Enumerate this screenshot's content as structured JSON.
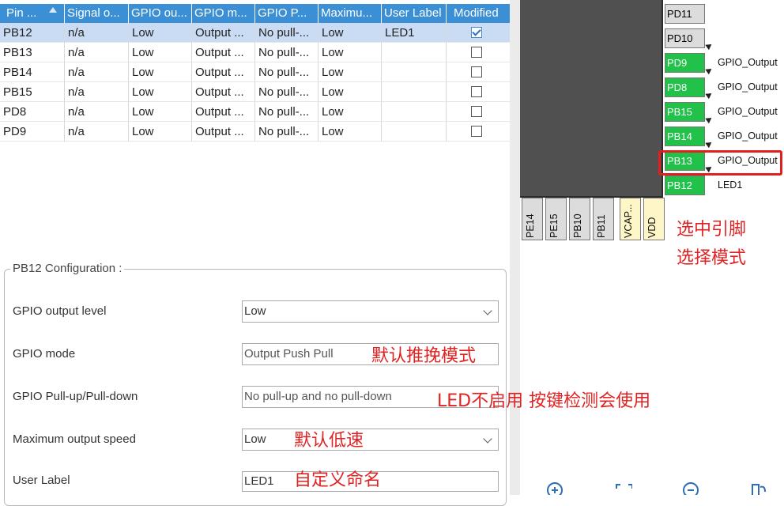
{
  "pin_table": {
    "columns": [
      "Pin ...",
      "Signal o...",
      "GPIO ou...",
      "GPIO m...",
      "GPIO P...",
      "Maximu...",
      "User Label",
      "Modified"
    ],
    "rows": [
      {
        "pin": "PB12",
        "signal": "n/a",
        "level": "Low",
        "mode": "Output ...",
        "pull": "No pull-...",
        "speed": "Low",
        "label": "LED1",
        "modified": true
      },
      {
        "pin": "PB13",
        "signal": "n/a",
        "level": "Low",
        "mode": "Output ...",
        "pull": "No pull-...",
        "speed": "Low",
        "label": "",
        "modified": false
      },
      {
        "pin": "PB14",
        "signal": "n/a",
        "level": "Low",
        "mode": "Output ...",
        "pull": "No pull-...",
        "speed": "Low",
        "label": "",
        "modified": false
      },
      {
        "pin": "PB15",
        "signal": "n/a",
        "level": "Low",
        "mode": "Output ...",
        "pull": "No pull-...",
        "speed": "Low",
        "label": "",
        "modified": false
      },
      {
        "pin": "PD8",
        "signal": "n/a",
        "level": "Low",
        "mode": "Output ...",
        "pull": "No pull-...",
        "speed": "Low",
        "label": "",
        "modified": false
      },
      {
        "pin": "PD9",
        "signal": "n/a",
        "level": "Low",
        "mode": "Output ...",
        "pull": "No pull-...",
        "speed": "Low",
        "label": "",
        "modified": false
      }
    ]
  },
  "config": {
    "title": "PB12 Configuration :",
    "fields": [
      {
        "label": "GPIO output level",
        "value": "Low",
        "dropdown": true
      },
      {
        "label": "GPIO mode",
        "value": "Output Push Pull",
        "dropdown": false
      },
      {
        "label": "GPIO Pull-up/Pull-down",
        "value": "No pull-up and no pull-down",
        "dropdown": false
      },
      {
        "label": "Maximum output speed",
        "value": "Low",
        "dropdown": true
      },
      {
        "label": "User Label",
        "value": "LED1",
        "dropdown": false
      }
    ]
  },
  "chip_view": {
    "right_pins": [
      {
        "name": "PD11",
        "active": false,
        "signal": ""
      },
      {
        "name": "PD10",
        "active": false,
        "signal": ""
      },
      {
        "name": "PD9",
        "active": true,
        "signal": "GPIO_Output"
      },
      {
        "name": "PD8",
        "active": true,
        "signal": "GPIO_Output"
      },
      {
        "name": "PB15",
        "active": true,
        "signal": "GPIO_Output"
      },
      {
        "name": "PB14",
        "active": true,
        "signal": "GPIO_Output"
      },
      {
        "name": "PB13",
        "active": true,
        "signal": "GPIO_Output"
      },
      {
        "name": "PB12",
        "active": true,
        "signal": "LED1"
      }
    ],
    "bottom_pins": [
      "PE14",
      "PE15",
      "PB10",
      "PB11",
      "VCAP...",
      "VDD"
    ],
    "highlighted_pin": "PB13"
  },
  "annotations": {
    "select_pin": "选中引脚",
    "select_mode": "选择模式",
    "default_push_pull": "默认推挽模式",
    "led_no_pull": "LED不启用 按键检测会使用",
    "default_low_speed": "默认低速",
    "custom_name": "自定义命名"
  },
  "colors": {
    "header_blue": "#3b8fd4",
    "selected_row": "#c9dcf4",
    "active_pin_green": "#22c24a",
    "annotation_red": "#e02222"
  }
}
